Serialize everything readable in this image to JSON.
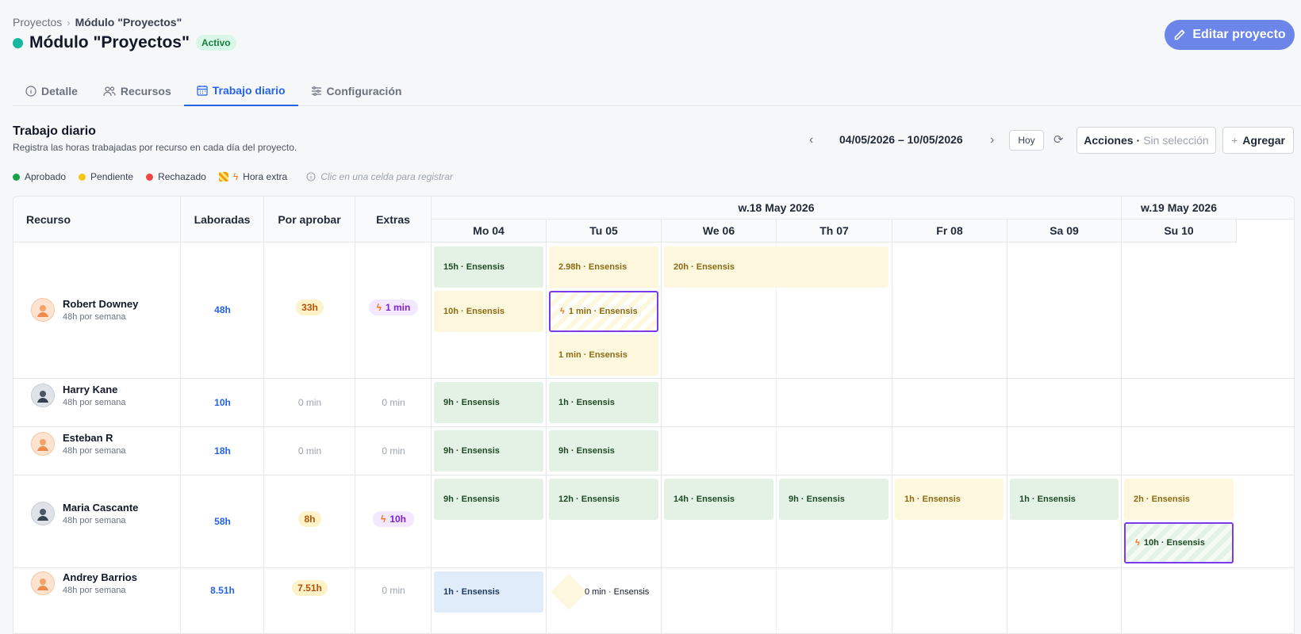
{
  "breadcrumb": {
    "parent": "Proyectos",
    "current": "Módulo \"Proyectos\""
  },
  "page": {
    "title": "Módulo \"Proyectos\"",
    "status": "Activo",
    "edit_label": "Editar proyecto"
  },
  "tabs": [
    {
      "label": "Detalle",
      "icon": "info-icon"
    },
    {
      "label": "Recursos",
      "icon": "users-icon"
    },
    {
      "label": "Trabajo diario",
      "icon": "calendar-icon",
      "active": true
    },
    {
      "label": "Configuración",
      "icon": "sliders-icon"
    }
  ],
  "section": {
    "title": "Trabajo diario",
    "subtitle": "Registra las horas trabajadas por recurso en cada día del proyecto."
  },
  "toolbar": {
    "date_range": "04/05/2026 – 10/05/2026",
    "today": "Hoy",
    "actions": "Acciones",
    "actions_sep": "·",
    "selection": "Sin selección",
    "add": "Agregar"
  },
  "legend": {
    "approved": "Aprobado",
    "pending": "Pendiente",
    "rejected": "Rechazado",
    "overtime": "Hora extra",
    "hint": "Clic en una celda para registrar"
  },
  "colors": {
    "approved": "#16a34a",
    "pending": "#f5c518",
    "rejected": "#ef4444",
    "accent": "#2563eb",
    "button": "#6b86e8",
    "overtime_border": "#7c3aed"
  },
  "table": {
    "headers": {
      "resource": "Recurso",
      "worked": "Laboradas",
      "to_approve": "Por aprobar",
      "extras": "Extras"
    },
    "weeks": [
      "w.18 May 2026",
      "w.19 May 2026"
    ],
    "days": [
      "Mo 04",
      "Tu 05",
      "We 06",
      "Th 07",
      "Fr 08",
      "Sa 09",
      "Su 10"
    ],
    "rows": [
      {
        "name": "Robert Downey",
        "sub": "48h por semana",
        "worked": "48h",
        "to_approve": "33h",
        "extras": "1 min",
        "entries": [
          {
            "text": "15h · Ensensis",
            "status": "approved"
          },
          {
            "text": "2.98h · Ensensis",
            "status": "pending"
          },
          {
            "text": "20h · Ensensis",
            "status": "pending"
          },
          {
            "text": "10h · Ensensis",
            "status": "pending"
          },
          {
            "text": "1 min · Ensensis",
            "status": "overtime"
          },
          {
            "text": "1 min · Ensensis",
            "status": "pending"
          }
        ]
      },
      {
        "name": "Harry Kane",
        "sub": "48h por semana",
        "worked": "10h",
        "to_approve": "0 min",
        "extras": "0 min",
        "entries": [
          {
            "text": "9h · Ensensis",
            "status": "approved"
          },
          {
            "text": "1h · Ensensis",
            "status": "approved"
          }
        ]
      },
      {
        "name": "Esteban R",
        "sub": "48h por semana",
        "worked": "18h",
        "to_approve": "0 min",
        "extras": "0 min",
        "entries": [
          {
            "text": "9h · Ensensis",
            "status": "approved"
          },
          {
            "text": "9h · Ensensis",
            "status": "approved"
          }
        ]
      },
      {
        "name": "Maria Cascante",
        "sub": "48h por semana",
        "worked": "58h",
        "to_approve": "8h",
        "extras": "10h",
        "entries": [
          {
            "text": "9h · Ensensis",
            "status": "approved"
          },
          {
            "text": "12h · Ensensis",
            "status": "approved"
          },
          {
            "text": "14h · Ensensis",
            "status": "approved"
          },
          {
            "text": "9h · Ensensis",
            "status": "approved"
          },
          {
            "text": "1h · Ensensis",
            "status": "pending"
          },
          {
            "text": "1h · Ensensis",
            "status": "approved"
          },
          {
            "text": "2h · Ensensis",
            "status": "pending"
          },
          {
            "text": "10h · Ensensis",
            "status": "overtime"
          }
        ]
      },
      {
        "name": "Andrey Barrios",
        "sub": "48h por semana",
        "worked": "8.51h",
        "to_approve": "7.51h",
        "extras": "0 min",
        "entries": [
          {
            "text": "1h · Ensensis",
            "status": "draft"
          },
          {
            "text": "0 min · Ensensis",
            "status": "pending"
          }
        ]
      }
    ]
  }
}
